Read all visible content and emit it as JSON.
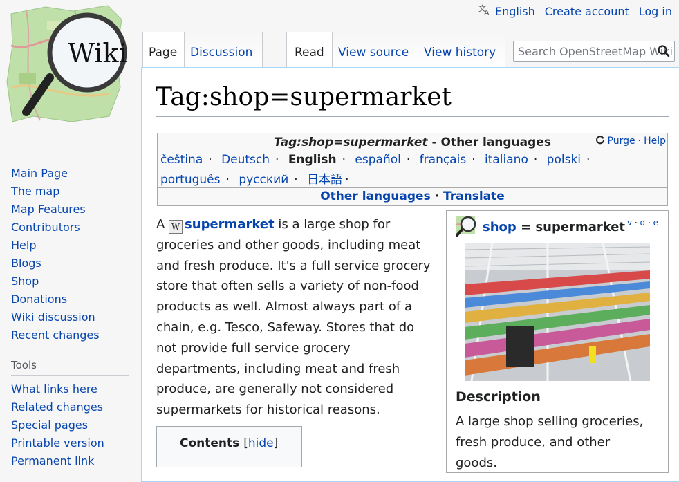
{
  "personal": {
    "language": "English",
    "create_account": "Create account",
    "login": "Log in"
  },
  "tabs": {
    "page": "Page",
    "discussion": "Discussion",
    "read": "Read",
    "view_source": "View source",
    "view_history": "View history"
  },
  "search": {
    "placeholder": "Search OpenStreetMap Wiki"
  },
  "page_title": "Tag:shop=supermarket",
  "languages_box": {
    "title_italic": "Tag:shop=supermarket",
    "title_rest": " - Other languages",
    "purge": "Purge",
    "help": "Help",
    "langs": [
      "čeština",
      "Deutsch",
      "English",
      "español",
      "français",
      "italiano",
      "polski",
      "português",
      "русский",
      "日本語"
    ],
    "current": "English",
    "footer_other": "Other languages",
    "footer_translate": "Translate"
  },
  "main": {
    "body_start": "A ",
    "body_link": "supermarket",
    "body_lines": [
      " is a large shop for",
      "groceries and other goods, including meat",
      "and fresh produce. It's a full service grocery",
      "store that often sells a variety of non-food",
      "products as well. Almost always part of a",
      "chain, e.g. Tesco, Safeway. Stores that do",
      "not provide full service grocery",
      "departments, including meat and fresh",
      "produce, are generally not considered",
      "supermarkets for historical reasons."
    ]
  },
  "toc": {
    "title": "Contents",
    "hide": "hide"
  },
  "infobox": {
    "key": "shop",
    "eq": "=",
    "value": "supermarket",
    "v": "v",
    "d": "d",
    "e": "e",
    "description_title": "Description",
    "description_lines": [
      "A large shop selling groceries,",
      "fresh produce, and other",
      "goods."
    ]
  },
  "sidebar": {
    "nav": [
      "Main Page",
      "The map",
      "Map Features",
      "Contributors",
      "Help",
      "Blogs",
      "Shop",
      "Donations",
      "Wiki discussion",
      "Recent changes"
    ],
    "tools_heading": "Tools",
    "tools": [
      "What links here",
      "Related changes",
      "Special pages",
      "Printable version",
      "Permanent link"
    ]
  },
  "logo_text": "Wiki",
  "colors": {
    "link": "#0645ad",
    "border": "#a7d7f9",
    "text": "#202122"
  }
}
